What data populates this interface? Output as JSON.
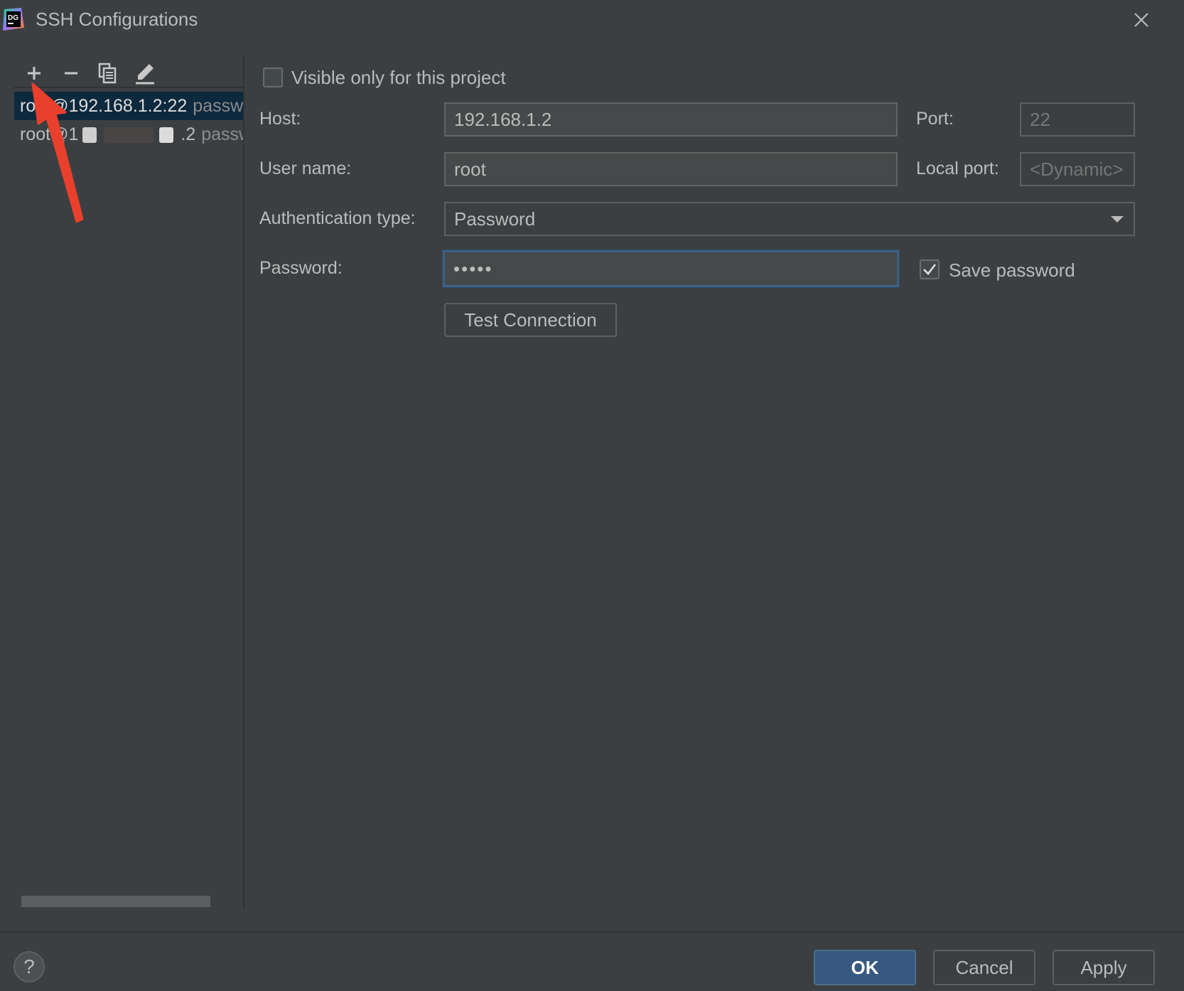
{
  "window": {
    "title": "SSH Configurations",
    "logo_text": "DG",
    "close_icon": "close-icon"
  },
  "toolbar": {
    "add_icon": "plus-icon",
    "remove_icon": "minus-icon",
    "copy_icon": "copy-icon",
    "edit_icon": "edit-icon"
  },
  "configs": [
    {
      "primary": "root@192.168.1.2:22",
      "secondary": "password",
      "selected": true
    },
    {
      "primary": "root@1",
      "masked": ".2",
      "secondary": "password",
      "selected": false
    }
  ],
  "form": {
    "visible_only_label": "Visible only for this project",
    "visible_only_checked": false,
    "host_label": "Host:",
    "host_value": "192.168.1.2",
    "port_label": "Port:",
    "port_value": "22",
    "user_label": "User name:",
    "user_value": "root",
    "local_port_label": "Local port:",
    "local_port_value": "<Dynamic>",
    "auth_label": "Authentication type:",
    "auth_value": "Password",
    "password_label": "Password:",
    "password_value": "•••••",
    "save_password_label": "Save password",
    "save_password_checked": true,
    "test_connection_label": "Test Connection"
  },
  "footer": {
    "help_label": "?",
    "ok_label": "OK",
    "cancel_label": "Cancel",
    "apply_label": "Apply"
  },
  "colors": {
    "background": "#3c3f41",
    "selection": "#0d293e",
    "focus": "#3d6185",
    "primary_button": "#365880",
    "annotation_arrow": "#e8402c"
  }
}
